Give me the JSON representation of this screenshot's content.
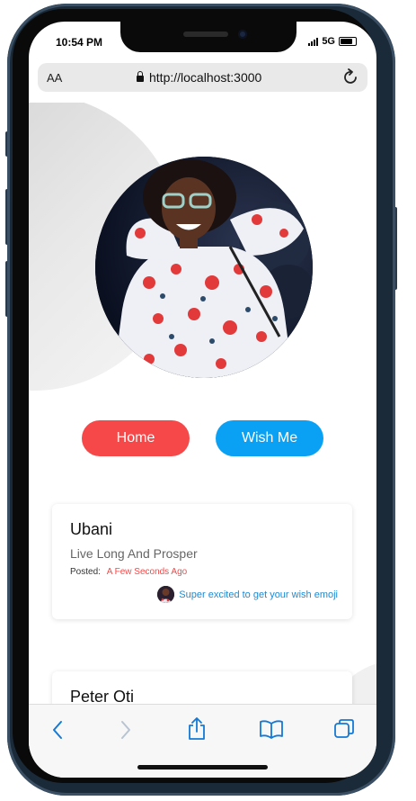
{
  "status_bar": {
    "time": "10:54 PM",
    "network": "5G"
  },
  "browser": {
    "text_size_label": "AA",
    "url": "http://localhost:3000"
  },
  "nav": {
    "home_label": "Home",
    "wish_me_label": "Wish Me"
  },
  "wishes": [
    {
      "name": "Ubani",
      "message": "Live Long And Prosper",
      "posted_label": "Posted:",
      "time": "A Few Seconds Ago",
      "wish_text": "Super excited to get your wish emoji"
    },
    {
      "name": "Peter Oti"
    }
  ],
  "colors": {
    "home_button": "#f64848",
    "wish_button": "#0aa1f5",
    "time_accent": "#f64848",
    "link_blue": "#1c8ad4",
    "toolbar_blue": "#1478d4"
  },
  "icons": [
    "lock-icon",
    "reload-icon",
    "back-icon",
    "forward-icon",
    "share-icon",
    "bookmarks-icon",
    "tabs-icon"
  ]
}
